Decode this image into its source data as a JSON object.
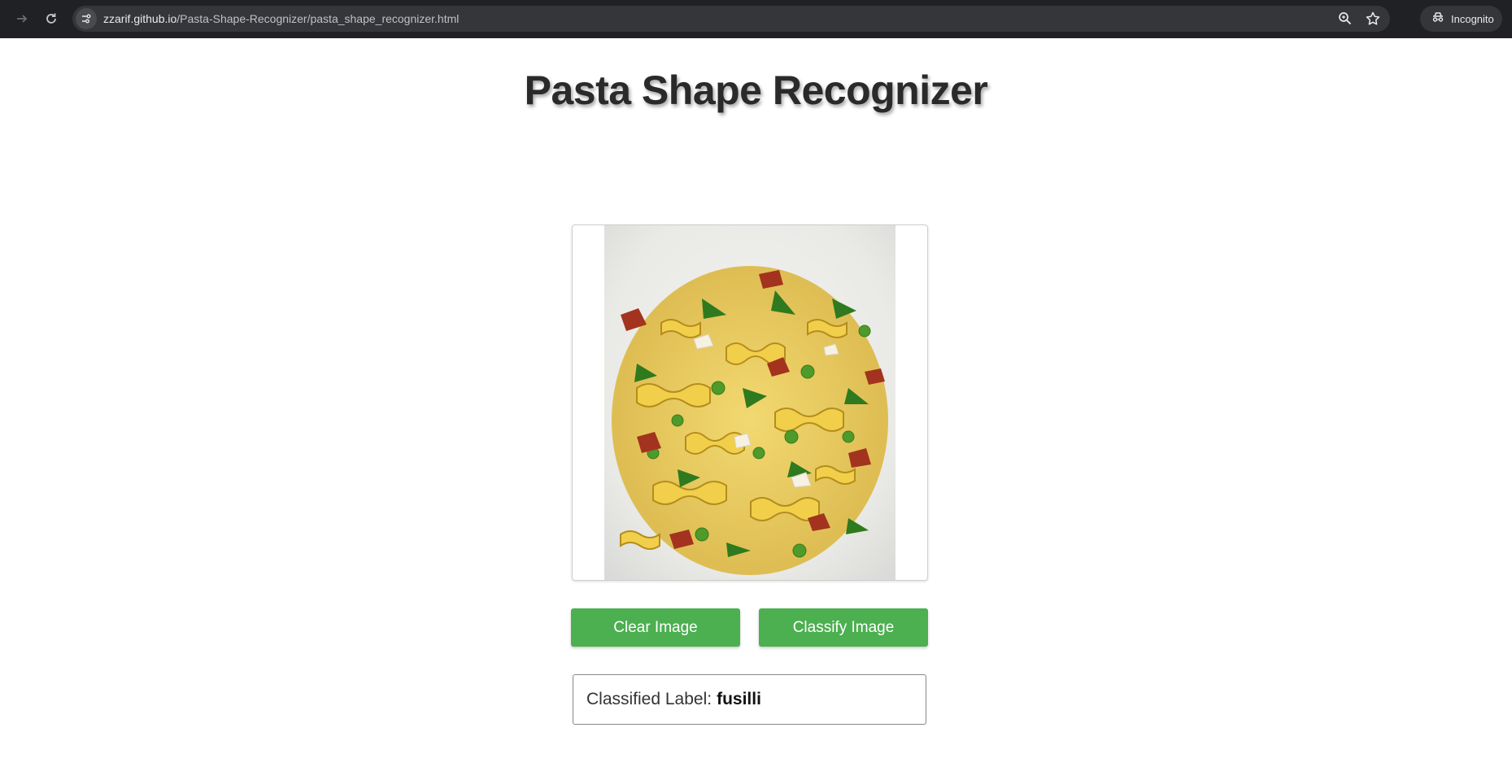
{
  "browser": {
    "url_host": "zzarif.github.io",
    "url_path": "/Pasta-Shape-Recognizer/pasta_shape_recognizer.html",
    "incognito_label": "Incognito",
    "icons": [
      "forward-icon",
      "reload-icon",
      "site-info-icon",
      "zoom-icon",
      "bookmark-star-icon",
      "incognito-icon"
    ]
  },
  "page": {
    "title": "Pasta Shape Recognizer",
    "image": {
      "subject": "fusilli pasta with peas, sun-dried tomatoes and arugula on a white plate"
    },
    "buttons": {
      "clear_label": "Clear Image",
      "classify_label": "Classify Image"
    },
    "result": {
      "label_prefix": "Classified Label:",
      "value": "fusilli"
    }
  },
  "colors": {
    "chrome_bg": "#202124",
    "omnibox_bg": "#35363a",
    "button_green": "#4caf50",
    "title_text": "#2a2a2a"
  }
}
